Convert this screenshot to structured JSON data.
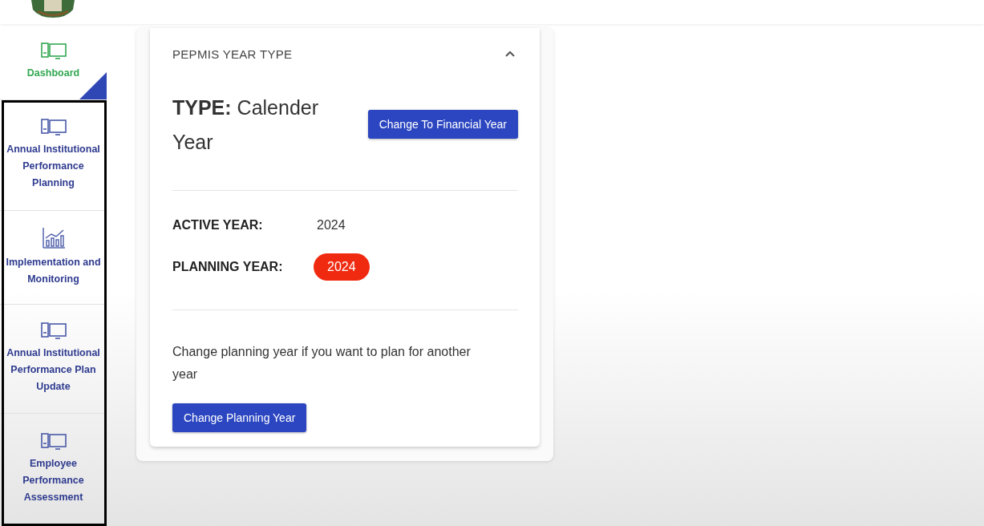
{
  "sidebar": {
    "items": [
      {
        "label": "Dashboard",
        "kind": "monitor",
        "selected": true
      },
      {
        "label": "Annual Institutional Performance Planning",
        "kind": "monitor",
        "selected": false
      },
      {
        "label": "Implementation and Monitoring",
        "kind": "chart",
        "selected": false
      },
      {
        "label": "Annual Institutional Performance Plan Update",
        "kind": "monitor",
        "selected": false
      },
      {
        "label": "Employee Performance Assessment",
        "kind": "monitor",
        "selected": false
      }
    ]
  },
  "panel": {
    "title": "PEPMIS YEAR TYPE",
    "expanded": true,
    "type_text": "**TYPE:** Calender Year",
    "type_button": "Change To Financial Year",
    "active_year_label": "ACTIVE YEAR:",
    "active_year": "2024",
    "planning_year_label": "PLANNING YEAR:",
    "planning_year": "2024",
    "hint": "Change planning year if you want to plan for another year",
    "planning_button": "Change Planning Year"
  }
}
